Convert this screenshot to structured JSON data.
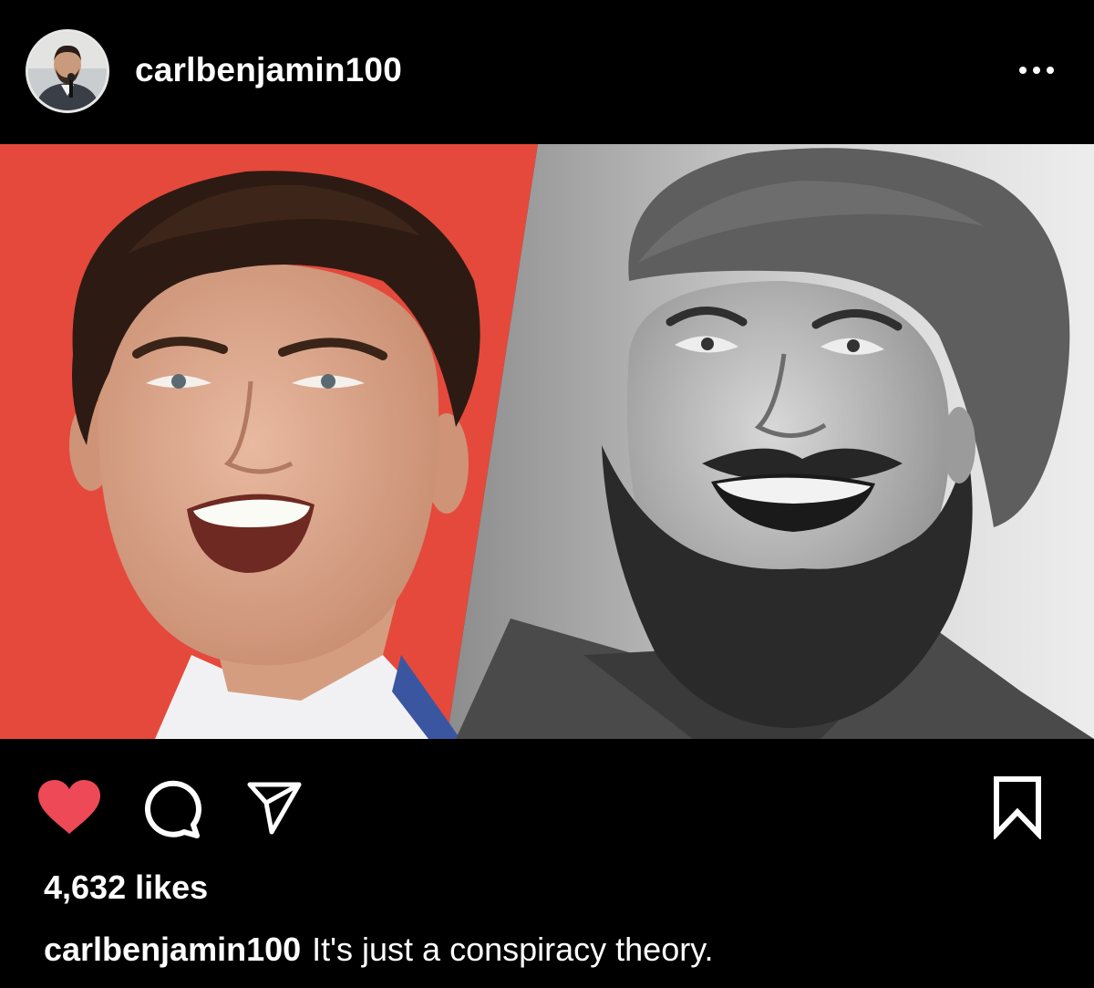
{
  "post": {
    "username": "carlbenjamin100",
    "likes_text": "4,632 likes",
    "caption_username": "carlbenjamin100",
    "caption_text": "It's just a conspiracy theory.",
    "liked": true
  },
  "icons": {
    "more": "more-horizontal-icon",
    "like": "heart-icon",
    "comment": "comment-icon",
    "share": "send-icon",
    "save": "bookmark-icon"
  },
  "colors": {
    "background": "#000000",
    "text": "#ffffff",
    "like_red": "#ed4956",
    "left_panel_red": "#e5493c"
  }
}
